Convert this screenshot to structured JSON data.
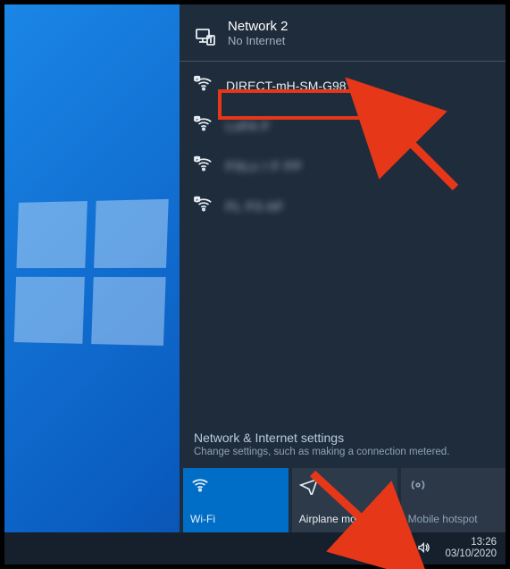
{
  "header": {
    "title": "Network 2",
    "subtitle": "No Internet"
  },
  "networks": [
    {
      "ssid": "DIRECT-mH-SM-G981B",
      "secured": true,
      "obscured": false
    },
    {
      "ssid": "LxFA F",
      "secured": true,
      "obscured": true
    },
    {
      "ssid": "FSLx I F FP",
      "secured": true,
      "obscured": true
    },
    {
      "ssid": "FL F3 AF",
      "secured": true,
      "obscured": true
    }
  ],
  "settings": {
    "title": "Network & Internet settings",
    "subtitle": "Change settings, such as making a connection metered."
  },
  "tiles": {
    "wifi": {
      "label": "Wi-Fi"
    },
    "airplane": {
      "label": "Airplane mode"
    },
    "hotspot": {
      "label": "Mobile hotspot"
    }
  },
  "clock": {
    "time": "13:26",
    "date": "03/10/2020"
  }
}
